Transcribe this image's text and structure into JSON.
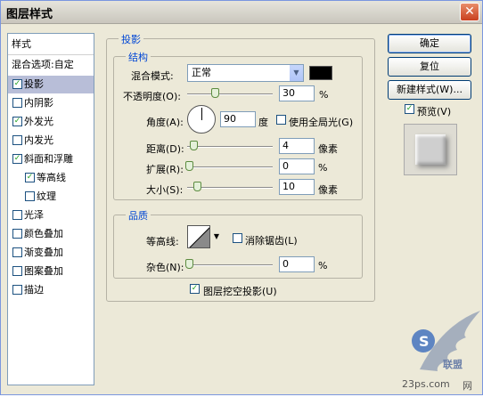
{
  "window": {
    "title": "图层样式",
    "close_glyph": "✕"
  },
  "sidebar": {
    "header": "样式",
    "blend_options": "混合选项:自定",
    "items": [
      {
        "label": "投影",
        "checked": true,
        "selected": true
      },
      {
        "label": "内阴影",
        "checked": false
      },
      {
        "label": "外发光",
        "checked": true
      },
      {
        "label": "内发光",
        "checked": false
      },
      {
        "label": "斜面和浮雕",
        "checked": true
      },
      {
        "label": "等高线",
        "checked": true,
        "indent": true
      },
      {
        "label": "纹理",
        "checked": false,
        "indent": true
      },
      {
        "label": "光泽",
        "checked": false
      },
      {
        "label": "颜色叠加",
        "checked": false
      },
      {
        "label": "渐变叠加",
        "checked": false
      },
      {
        "label": "图案叠加",
        "checked": false
      },
      {
        "label": "描边",
        "checked": false
      }
    ]
  },
  "drop_shadow": {
    "group_title": "投影",
    "structure": {
      "title": "结构",
      "blend_mode_label": "混合模式:",
      "blend_mode_value": "正常",
      "shadow_color": "#000000",
      "opacity_label": "不透明度(O):",
      "opacity_value": "30",
      "angle_label": "角度(A):",
      "angle_value": "90",
      "angle_unit": "度",
      "global_light_label": "使用全局光(G)",
      "global_light_checked": false,
      "distance_label": "距离(D):",
      "distance_value": "4",
      "size_unit": "像素",
      "spread_label": "扩展(R):",
      "spread_value": "0",
      "size_label": "大小(S):",
      "size_value": "10",
      "percent": "%"
    },
    "quality": {
      "title": "品质",
      "contour_label": "等高线:",
      "anti_alias_label": "消除锯齿(L)",
      "anti_alias_checked": false,
      "noise_label": "杂色(N):",
      "noise_value": "0",
      "knockout_label": "图层挖空投影(U)",
      "knockout_checked": true
    }
  },
  "buttons": {
    "ok": "确定",
    "reset": "复位",
    "new_style": "新建样式(W)...",
    "preview_label": "预览(V)",
    "preview_checked": true
  },
  "watermark": {
    "line1": "23ps.com",
    "line2": "网",
    "line3": "联盟"
  },
  "check_glyph": "✓",
  "dropdown_glyph": "▼"
}
